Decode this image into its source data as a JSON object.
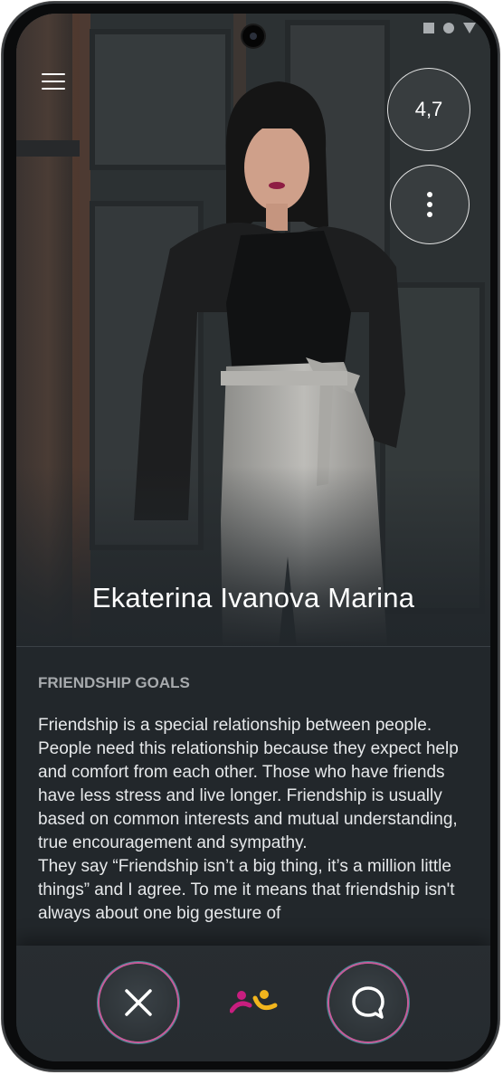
{
  "header": {
    "rating": "4,7"
  },
  "profile": {
    "name": "Ekaterina Ivanova Marina"
  },
  "section": {
    "title": "FRIENDSHIP GOALS",
    "body": "Friendship is a special relationship between people. People need this relationship because they expect help and comfort from each other. Those who have friends have less stress and live longer. Friendship is usually based on common interests and mutual understanding, true encouragement and sympathy.\nThey say “Friendship isn’t a big thing, it’s a million little things” and I agree. To me it means that friendship isn't always about one big gesture of"
  },
  "icons": {
    "menu": "hamburger-menu-icon",
    "more": "vertical-dots-icon",
    "dislike": "close-icon",
    "chat": "chat-bubble-icon",
    "logo": "people-logo-icon"
  },
  "colors": {
    "background": "#22272b",
    "accent_pink": "#c81e7f",
    "accent_yellow": "#f2b51d",
    "ring_pink": "#c85a99",
    "ring_cyan": "#4fc8d2"
  }
}
